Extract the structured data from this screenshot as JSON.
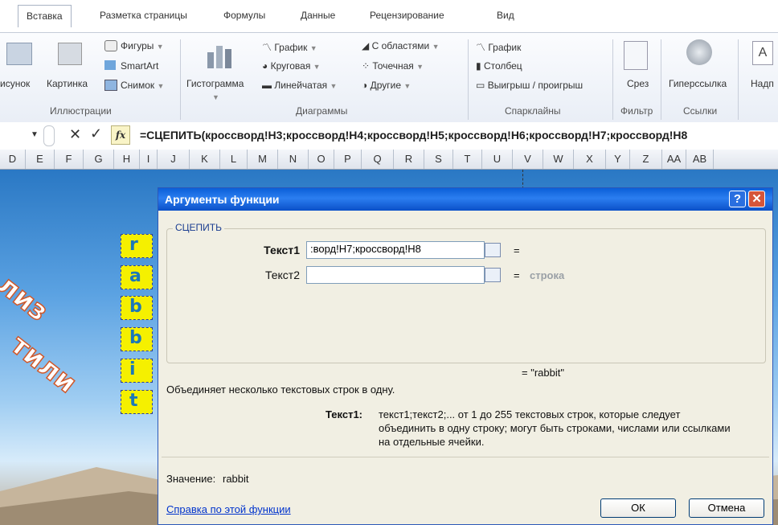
{
  "tabs": [
    "Вставка",
    "Разметка страницы",
    "Формулы",
    "Данные",
    "Рецензирование",
    "Вид"
  ],
  "ribbon": {
    "illustrations": {
      "picture": "исунок",
      "clipart": "Картинка",
      "shapes": "Фигуры",
      "smartart": "SmartArt",
      "screenshot": "Снимок",
      "group": "Иллюстрации"
    },
    "charts": {
      "histogram": "Гистограмма",
      "graph": "График",
      "pie": "Круговая",
      "linear": "Линейчатая",
      "area": "С областями",
      "scatter": "Точечная",
      "other": "Другие",
      "group": "Диаграммы"
    },
    "sparklines": {
      "graph": "График",
      "column": "Столбец",
      "winloss": "Выигрыш / проигрыш",
      "group": "Спарклайны"
    },
    "filter": {
      "slicer": "Срез",
      "group": "Фильтр"
    },
    "links": {
      "hyperlink": "Гиперссылка",
      "group": "Ссылки"
    },
    "text": {
      "label": "Надп"
    }
  },
  "formula_bar": {
    "fx": "fx",
    "formula": "=СЦЕПИТЬ(кроссворд!H3;кроссворд!H4;кроссворд!H5;кроссворд!H6;кроссворд!H7;кроссворд!H8"
  },
  "columns": [
    "D",
    "E",
    "F",
    "G",
    "H",
    "I",
    "J",
    "K",
    "L",
    "M",
    "N",
    "O",
    "P",
    "Q",
    "R",
    "S",
    "T",
    "U",
    "V",
    "W",
    "X",
    "Y",
    "Z",
    "AA",
    "AB"
  ],
  "sheet": {
    "wordart1": "лиз",
    "wordart2": "тили",
    "letters": [
      "r",
      "a",
      "b",
      "b",
      "i",
      "t"
    ]
  },
  "dialog": {
    "title": "Аргументы функции",
    "help_btn": "?",
    "close_btn": "✕",
    "group": "СЦЕПИТЬ",
    "arg1_label": "Текст1",
    "arg1_value": ":ворд!H7;кроссворд!H8",
    "arg2_label": "Текст2",
    "arg2_value": "",
    "eq": "=",
    "arg2_hint": "строка",
    "result": "= \"rabbit\"",
    "description": "Объединяет несколько текстовых строк в одну.",
    "arg_help_label": "Текст1:",
    "arg_help_line1": "текст1;текст2;... от 1 до 255 текстовых строк, которые следует",
    "arg_help_line2": "объединить в одну строку; могут быть строками, числами или ссылками",
    "arg_help_line3": "на отдельные ячейки.",
    "value_label": "Значение:",
    "value": "rabbit",
    "help_link": "Справка по этой функции",
    "ok": "ОК",
    "cancel": "Отмена"
  }
}
